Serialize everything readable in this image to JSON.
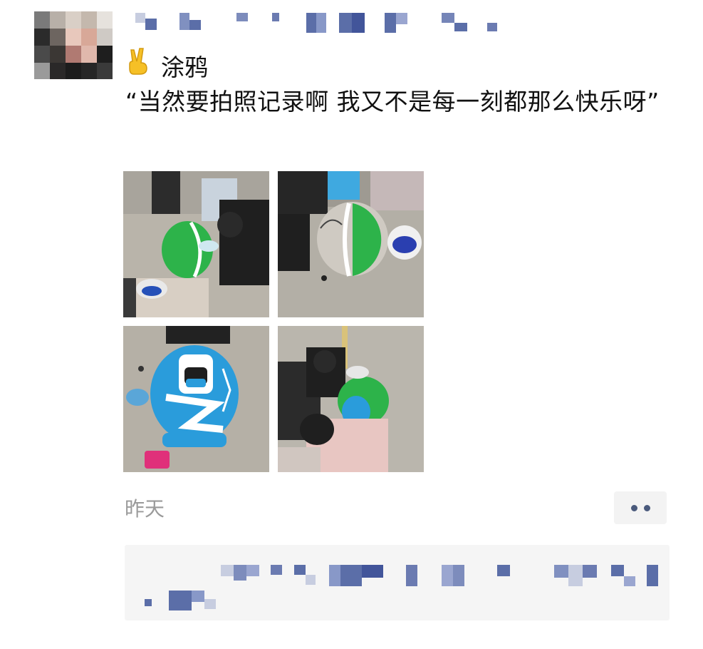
{
  "post": {
    "title": "涂鸦",
    "emoji": "victory-hand-emoji",
    "text": "“当然要拍照记录啊 我又不是每一刻都那么快乐呀”",
    "timestamp": "昨天"
  },
  "photos": [
    {
      "name": "photo-painting-green-ball-1"
    },
    {
      "name": "photo-green-white-ball-sketch"
    },
    {
      "name": "photo-blue-ball-nurse-mural"
    },
    {
      "name": "photo-kids-painting-ball"
    }
  ],
  "colors": {
    "blur_name": "#5b6ea8",
    "blur_light": "#c7cde0",
    "timestamp": "#9a9a9a",
    "more_dots": "#4a5a7c"
  }
}
